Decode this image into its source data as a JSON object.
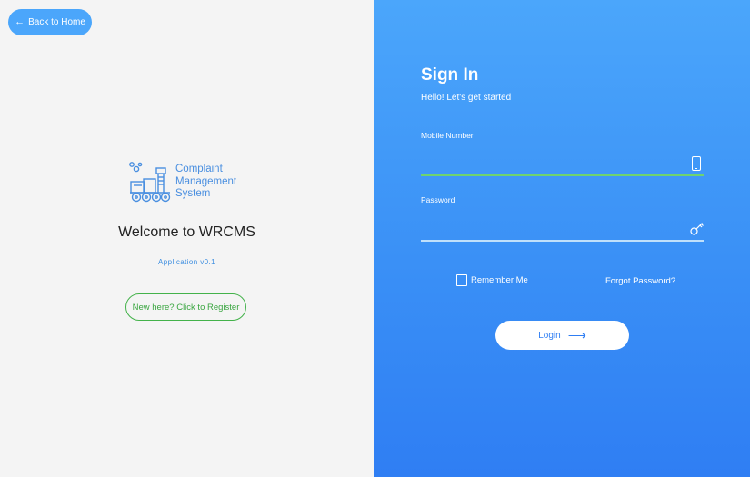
{
  "left": {
    "back_label": "Back to Home",
    "logo_lines": [
      "Complaint",
      "Management",
      "System"
    ],
    "welcome": "Welcome to WRCMS",
    "version": "Application v0.1",
    "register_label": "New here? Click to Register"
  },
  "right": {
    "title": "Sign In",
    "subtitle": "Hello! Let's get started",
    "mobile_label": "Mobile Number",
    "mobile_value": "",
    "password_label": "Password",
    "password_value": "",
    "remember_label": "Remember Me",
    "remember_checked": false,
    "forgot_label": "Forgot Password?",
    "login_label": "Login"
  },
  "icons": {
    "back": "arrow-left-icon",
    "logo": "train-engine-icon",
    "mobile": "phone-icon",
    "password": "key-icon",
    "login": "arrow-right-icon"
  },
  "colors": {
    "accent": "#4ba6fb",
    "register": "#43b24a",
    "panel_gradient_top": "#4ba6fb",
    "panel_gradient_bottom": "#2f7ef3"
  }
}
